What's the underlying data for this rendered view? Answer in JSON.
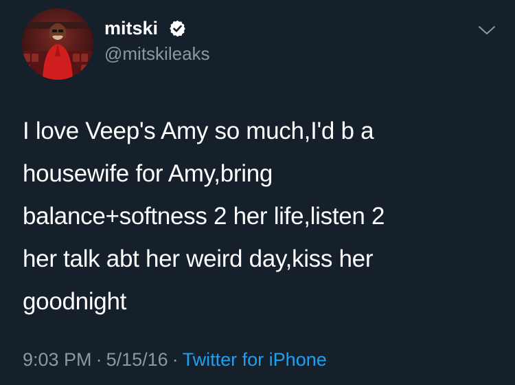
{
  "author": {
    "display_name": "mitski",
    "handle": "@mitskileaks",
    "verified": true,
    "avatar_icon": "profile-photo"
  },
  "tweet": {
    "text": "I love Veep's Amy so much,I'd b a\nhousewife for Amy,bring\nbalance+softness 2 her life,listen 2\nher talk abt her weird day,kiss her\ngoodnight"
  },
  "meta": {
    "time": "9:03 PM",
    "separator": "·",
    "date": "5/15/16",
    "source": "Twitter for iPhone"
  },
  "icons": {
    "verified": "verified-badge-icon",
    "menu": "chevron-down-icon"
  },
  "colors": {
    "background": "#15202b",
    "text": "#ffffff",
    "secondary": "#8899a6",
    "link": "#1da1f2"
  }
}
